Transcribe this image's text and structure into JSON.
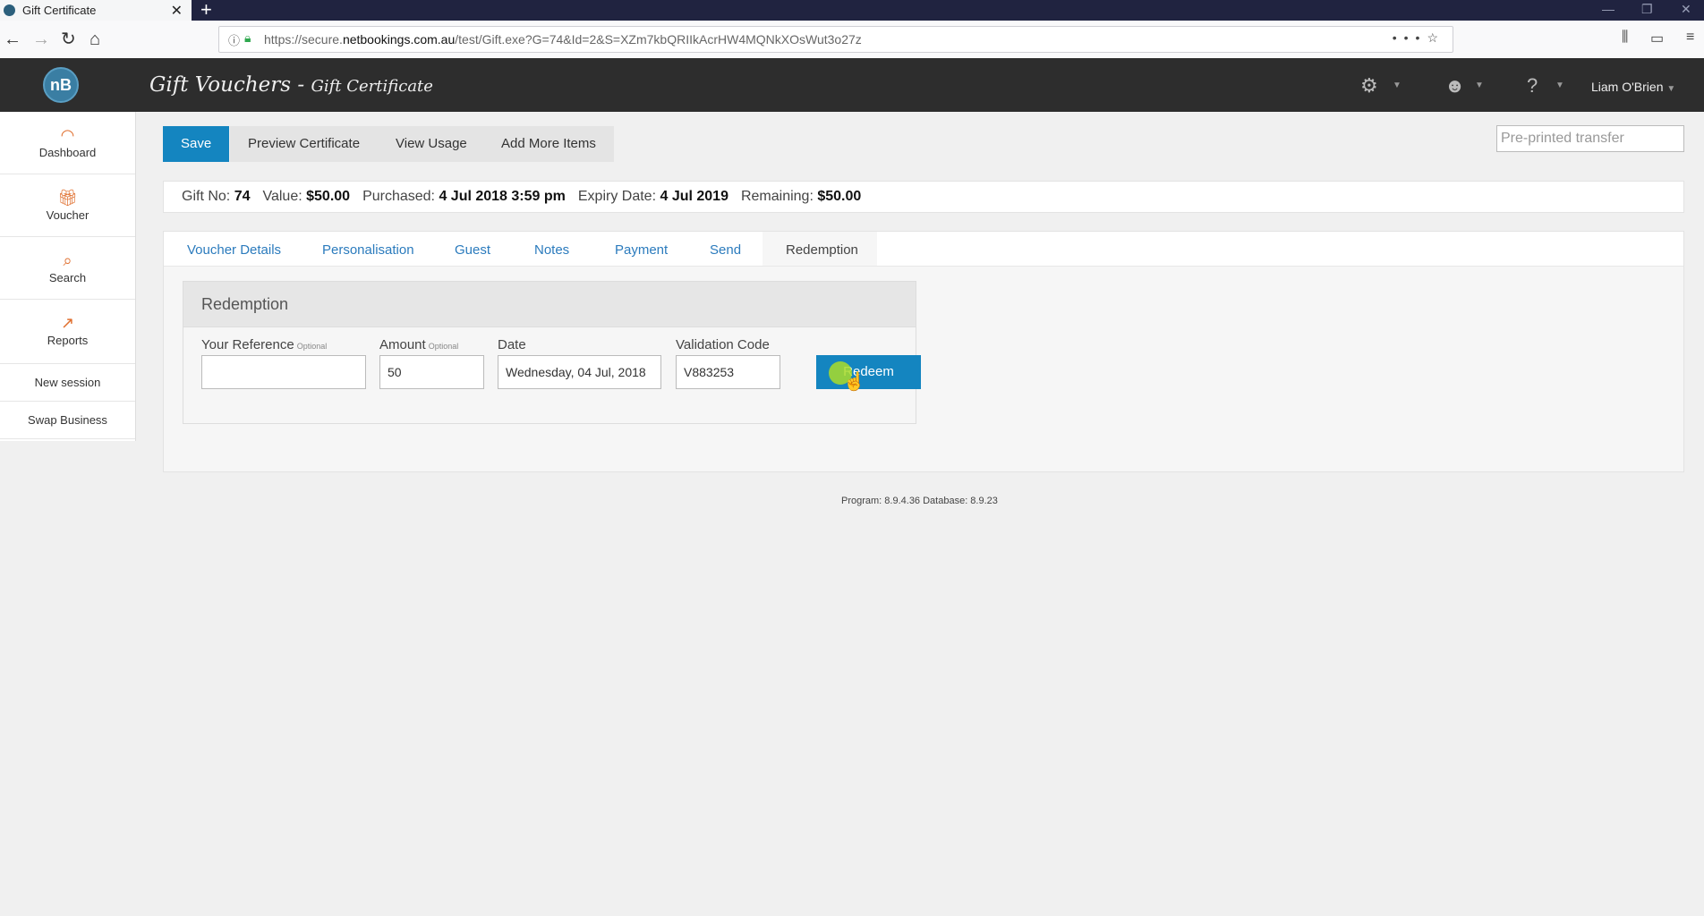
{
  "browser": {
    "tab_title": "Gift Certificate",
    "tab_close": "✕",
    "new_tab": "+",
    "url_prefix": "https://secure.",
    "url_domain": "netbookings.com.au",
    "url_path": "/test/Gift.exe?G=74&Id=2&S=XZm7kbQRIIkAcrHW4MQNkXOsWut3o27z"
  },
  "header": {
    "logo_text": "nB",
    "title": "Gift Vouchers - ",
    "subtitle": "Gift Certificate",
    "user_name": "Liam O'Brien"
  },
  "sidebar": {
    "items": [
      {
        "label": "Dashboard",
        "icon": "dashboard-icon"
      },
      {
        "label": "Voucher",
        "icon": "gift-icon"
      },
      {
        "label": "Search",
        "icon": "search-icon"
      },
      {
        "label": "Reports",
        "icon": "chart-icon"
      }
    ],
    "links": [
      "New session",
      "Swap Business"
    ]
  },
  "toolbar": {
    "save_label": "Save",
    "preview_label": "Preview Certificate",
    "usage_label": "View Usage",
    "add_label": "Add More Items",
    "preprinted_placeholder": "Pre-printed transfer"
  },
  "info": {
    "gift_no_label": "Gift No:",
    "gift_no": "74",
    "value_label": "Value:",
    "value": "$50.00",
    "purchased_label": "Purchased:",
    "purchased": "4 Jul 2018 3:59 pm",
    "expiry_label": "Expiry Date:",
    "expiry": "4 Jul 2019",
    "remaining_label": "Remaining:",
    "remaining": "$50.00"
  },
  "tabs": [
    "Voucher Details",
    "Personalisation",
    "Guest",
    "Notes",
    "Payment",
    "Send",
    "Redemption"
  ],
  "redemption": {
    "heading": "Redemption",
    "reference_label": "Your Reference",
    "reference_hint": "Optional",
    "reference_value": "",
    "amount_label": "Amount",
    "amount_hint": "Optional",
    "amount_value": "50",
    "date_label": "Date",
    "date_value": "Wednesday, 04 Jul, 2018",
    "code_label": "Validation Code",
    "code_value": "V883253",
    "redeem_label": "Redeem"
  },
  "footer": {
    "version": "Program: 8.9.4.36 Database: 8.9.23"
  },
  "colors": {
    "primary": "#1485c0",
    "header_bg": "#2d2d2d",
    "tab_link": "#2b7bbd",
    "sidebar_icon": "#e07030"
  }
}
